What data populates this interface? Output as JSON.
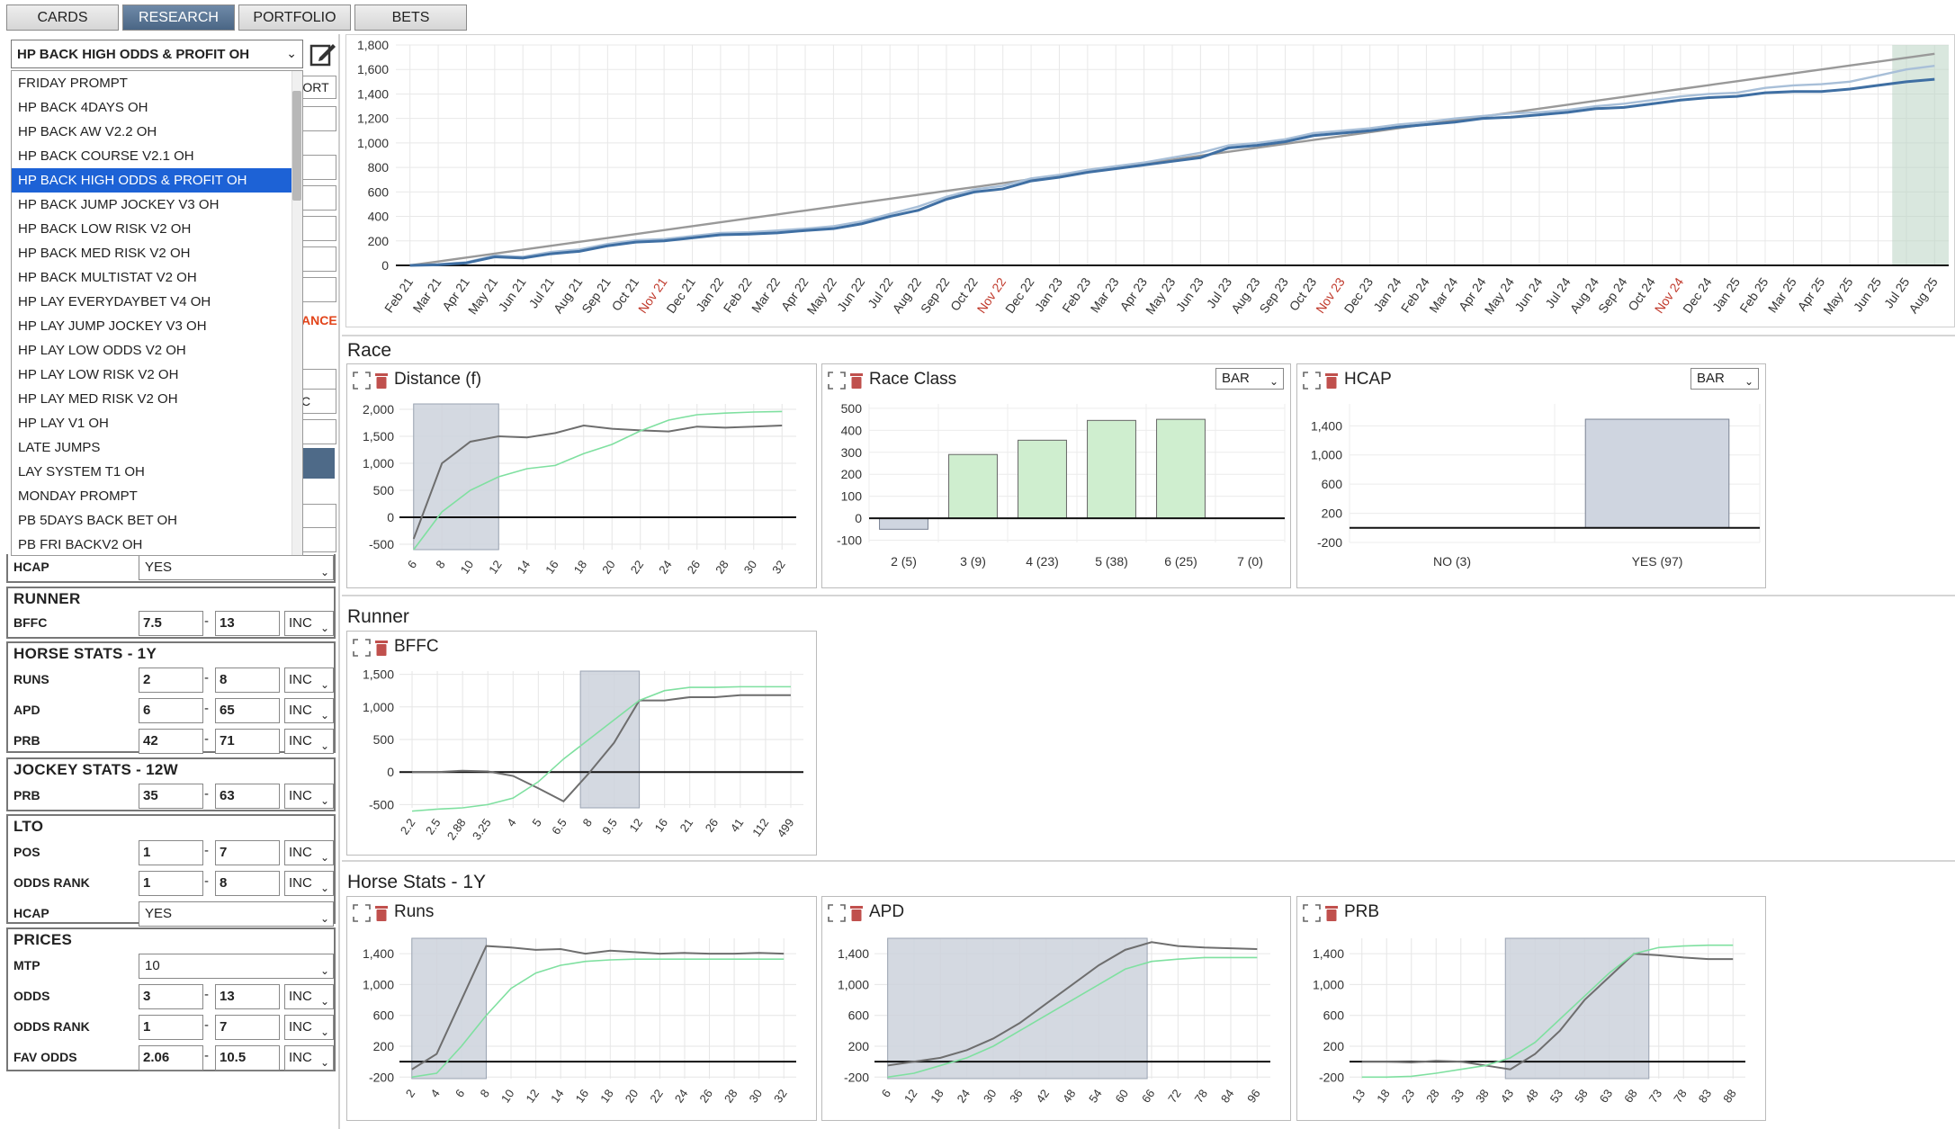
{
  "tabs": [
    "CARDS",
    "RESEARCH",
    "PORTFOLIO",
    "BETS"
  ],
  "system_select": {
    "value": "HP BACK HIGH ODDS & PROFIT OH"
  },
  "dropdown_items": [
    "FRIDAY PROMPT",
    "HP BACK 4DAYS OH",
    "HP BACK AW V2.2 OH",
    "HP BACK COURSE V2.1 OH",
    "HP BACK HIGH ODDS & PROFIT OH",
    "HP BACK JUMP JOCKEY V3 OH",
    "HP BACK LOW RISK V2 OH",
    "HP BACK MED RISK V2 OH",
    "HP BACK MULTISTAT V2 OH",
    "HP LAY EVERYDAYBET V4 OH",
    "HP LAY JUMP JOCKEY V3 OH",
    "HP LAY LOW ODDS V2 OH",
    "HP LAY LOW RISK V2 OH",
    "HP LAY MED RISK V2 OH",
    "HP LAY V1 OH",
    "LATE JUMPS",
    "LAY SYSTEM T1 OH",
    "MONDAY PROMPT",
    "PB 5DAYS BACK BET OH",
    "PB FRI BACKV2 OH"
  ],
  "dropdown_selected_index": 4,
  "partial_labels": {
    "port": "PORT",
    "ance": "ANCE",
    "c": "C"
  },
  "filters": {
    "hcap_top": {
      "label": "HCAP",
      "value": "YES"
    },
    "runner": {
      "title": "RUNNER",
      "bffc": {
        "label": "BFFC",
        "min": "7.5",
        "max": "13",
        "mode": "INC"
      }
    },
    "horse_stats": {
      "title": "HORSE STATS - 1Y",
      "rows": [
        {
          "label": "RUNS",
          "min": "2",
          "max": "8",
          "mode": "INC"
        },
        {
          "label": "APD",
          "min": "6",
          "max": "65",
          "mode": "INC"
        },
        {
          "label": "PRB",
          "min": "42",
          "max": "71",
          "mode": "INC"
        }
      ]
    },
    "jockey_stats": {
      "title": "JOCKEY STATS - 12W",
      "rows": [
        {
          "label": "PRB",
          "min": "35",
          "max": "63",
          "mode": "INC"
        }
      ]
    },
    "lto": {
      "title": "LTO",
      "rows": [
        {
          "label": "POS",
          "min": "1",
          "max": "7",
          "mode": "INC"
        },
        {
          "label": "ODDS RANK",
          "min": "1",
          "max": "8",
          "mode": "INC"
        }
      ],
      "hcap": {
        "label": "HCAP",
        "value": "YES"
      }
    },
    "prices": {
      "title": "PRICES",
      "mtp": {
        "label": "MTP",
        "value": "10"
      },
      "rows": [
        {
          "label": "ODDS",
          "min": "3",
          "max": "13",
          "mode": "INC"
        },
        {
          "label": "ODDS RANK",
          "min": "1",
          "max": "7",
          "mode": "INC"
        },
        {
          "label": "FAV ODDS",
          "min": "2.06",
          "max": "10.5",
          "mode": "INC"
        }
      ]
    }
  },
  "sections": {
    "race": "Race",
    "runner": "Runner",
    "horse_stats": "Horse Stats - 1Y"
  },
  "panel_select_value": "BAR",
  "colors": {
    "accent": "#4a6685",
    "selected": "#1d62d6",
    "green_line": "#7fe0a0",
    "dark_line": "#6e6e6e",
    "band": "#cdd2dc",
    "bar_green": "#cfeecf",
    "bar_gray": "#cfd5e0",
    "main_blue": "#3f6fa3",
    "main_light": "#a8bfd8",
    "trend": "#999999"
  },
  "chart_data": [
    {
      "id": "main",
      "type": "line",
      "x": [
        "Feb 21",
        "Mar 21",
        "Apr 21",
        "May 21",
        "Jun 21",
        "Jul 21",
        "Aug 21",
        "Sep 21",
        "Oct 21",
        "Nov 21",
        "Dec 21",
        "Jan 22",
        "Feb 22",
        "Mar 22",
        "Apr 22",
        "May 22",
        "Jun 22",
        "Jul 22",
        "Aug 22",
        "Sep 22",
        "Oct 22",
        "Nov 22",
        "Dec 22",
        "Jan 23",
        "Feb 23",
        "Mar 23",
        "Apr 23",
        "May 23",
        "Jun 23",
        "Jul 23",
        "Aug 23",
        "Sep 23",
        "Oct 23",
        "Nov 23",
        "Dec 23",
        "Jan 24",
        "Feb 24",
        "Mar 24",
        "Apr 24",
        "May 24",
        "Jun 24",
        "Jul 24",
        "Aug 24",
        "Sep 24",
        "Oct 24",
        "Nov 24",
        "Dec 24",
        "Jan 25",
        "Feb 25",
        "Mar 25",
        "Apr 25",
        "May 25",
        "Jun 25",
        "Jul 25",
        "Aug 25"
      ],
      "yticks": [
        0,
        200,
        400,
        600,
        800,
        1000,
        1200,
        1400,
        1600,
        1800
      ],
      "ylim": [
        0,
        1800
      ],
      "x_red_ticks": [
        "Nov 21",
        "Nov 22",
        "Nov 23",
        "Nov 24"
      ],
      "highlight_range": [
        52.5,
        54.6
      ],
      "series": [
        {
          "role": "trend",
          "values": [
            0,
            32,
            64,
            96,
            128,
            160,
            192,
            224,
            256,
            288,
            320,
            352,
            384,
            416,
            448,
            480,
            512,
            544,
            576,
            608,
            640,
            672,
            704,
            736,
            768,
            800,
            832,
            864,
            896,
            928,
            960,
            992,
            1024,
            1056,
            1088,
            1120,
            1152,
            1184,
            1216,
            1248,
            1280,
            1312,
            1344,
            1376,
            1408,
            1440,
            1472,
            1504,
            1536,
            1568,
            1600,
            1632,
            1664,
            1696,
            1728
          ]
        },
        {
          "role": "light",
          "values": [
            0,
            10,
            25,
            80,
            70,
            110,
            130,
            175,
            205,
            215,
            240,
            265,
            270,
            285,
            300,
            320,
            360,
            420,
            480,
            560,
            620,
            650,
            710,
            740,
            780,
            810,
            840,
            880,
            920,
            980,
            1000,
            1030,
            1080,
            1100,
            1120,
            1150,
            1170,
            1200,
            1220,
            1240,
            1250,
            1270,
            1300,
            1320,
            1350,
            1380,
            1400,
            1410,
            1450,
            1470,
            1480,
            1500,
            1550,
            1600,
            1630
          ]
        },
        {
          "role": "dark",
          "values": [
            0,
            5,
            20,
            70,
            60,
            95,
            115,
            160,
            190,
            200,
            225,
            250,
            255,
            265,
            285,
            300,
            340,
            400,
            450,
            540,
            600,
            625,
            690,
            720,
            760,
            790,
            820,
            850,
            880,
            960,
            980,
            1010,
            1060,
            1080,
            1100,
            1130,
            1150,
            1170,
            1200,
            1210,
            1230,
            1250,
            1280,
            1290,
            1320,
            1350,
            1370,
            1380,
            1410,
            1420,
            1420,
            1440,
            1470,
            1500,
            1520
          ]
        }
      ]
    },
    {
      "id": "distance",
      "title": "Distance (f)",
      "type": "line",
      "x": [
        6,
        8,
        10,
        12,
        14,
        16,
        18,
        20,
        22,
        24,
        26,
        28,
        30,
        32
      ],
      "yticks": [
        2000,
        1500,
        1000,
        500,
        0,
        -500
      ],
      "ylim": [
        -600,
        2100
      ],
      "highlight_range": [
        6,
        12
      ],
      "series": [
        {
          "role": "dark",
          "values": [
            -400,
            1000,
            1400,
            1500,
            1480,
            1560,
            1700,
            1640,
            1610,
            1590,
            1680,
            1660,
            1680,
            1700
          ]
        },
        {
          "role": "green",
          "values": [
            -600,
            100,
            500,
            750,
            900,
            960,
            1180,
            1350,
            1600,
            1800,
            1900,
            1930,
            1950,
            1960
          ]
        }
      ]
    },
    {
      "id": "race_class",
      "title": "Race Class",
      "type": "bar",
      "categories": [
        "2 (5)",
        "3 (9)",
        "4 (23)",
        "5 (38)",
        "6 (25)",
        "7 (0)"
      ],
      "values": [
        -50,
        290,
        355,
        445,
        450,
        0
      ],
      "yticks": [
        500,
        400,
        300,
        200,
        100,
        0,
        -100
      ],
      "ylim": [
        -110,
        520
      ]
    },
    {
      "id": "hcap",
      "title": "HCAP",
      "type": "bar",
      "categories": [
        "NO (3)",
        "YES (97)"
      ],
      "values": [
        0,
        1490
      ],
      "yticks": [
        1400,
        1000,
        600,
        200,
        -200
      ],
      "ylim": [
        -200,
        1700
      ]
    },
    {
      "id": "bffc",
      "title": "BFFC",
      "type": "line",
      "x": [
        "2.2",
        "2.5",
        "2.88",
        "3.25",
        "4",
        "5",
        "6.5",
        "8",
        "9.5",
        "12",
        "16",
        "21",
        "26",
        "41",
        "112",
        "499"
      ],
      "yticks": [
        1500,
        1000,
        500,
        0,
        -500
      ],
      "ylim": [
        -550,
        1550
      ],
      "highlight_range": [
        7.5,
        12
      ],
      "series": [
        {
          "role": "dark",
          "values": [
            0,
            0,
            20,
            10,
            -60,
            -250,
            -450,
            -20,
            450,
            1100,
            1100,
            1150,
            1150,
            1180,
            1180,
            1180
          ]
        },
        {
          "role": "green",
          "values": [
            -600,
            -570,
            -550,
            -500,
            -400,
            -150,
            200,
            500,
            800,
            1100,
            1250,
            1300,
            1300,
            1310,
            1310,
            1310
          ]
        }
      ]
    },
    {
      "id": "runs",
      "title": "Runs",
      "type": "line",
      "x": [
        2,
        4,
        6,
        8,
        10,
        12,
        14,
        16,
        18,
        20,
        22,
        24,
        26,
        28,
        30,
        32
      ],
      "yticks": [
        1400,
        1000,
        600,
        200,
        -200
      ],
      "ylim": [
        -220,
        1600
      ],
      "highlight_range": [
        2,
        8
      ],
      "series": [
        {
          "role": "dark",
          "values": [
            -100,
            100,
            800,
            1500,
            1480,
            1450,
            1460,
            1400,
            1440,
            1420,
            1400,
            1410,
            1400,
            1400,
            1410,
            1400
          ]
        },
        {
          "role": "green",
          "values": [
            -200,
            -150,
            200,
            600,
            950,
            1150,
            1250,
            1300,
            1320,
            1330,
            1330,
            1330,
            1330,
            1330,
            1330,
            1330
          ]
        }
      ]
    },
    {
      "id": "apd",
      "title": "APD",
      "type": "line",
      "x": [
        6,
        12,
        18,
        24,
        30,
        36,
        42,
        48,
        54,
        60,
        66,
        72,
        78,
        84,
        96
      ],
      "yticks": [
        1400,
        1000,
        600,
        200,
        -200
      ],
      "ylim": [
        -220,
        1600
      ],
      "highlight_range": [
        6,
        65
      ],
      "series": [
        {
          "role": "dark",
          "values": [
            -50,
            0,
            50,
            150,
            300,
            500,
            750,
            1000,
            1250,
            1450,
            1550,
            1500,
            1480,
            1470,
            1460
          ]
        },
        {
          "role": "green",
          "values": [
            -200,
            -150,
            -50,
            50,
            200,
            400,
            600,
            800,
            1000,
            1200,
            1300,
            1330,
            1350,
            1350,
            1350
          ]
        }
      ]
    },
    {
      "id": "prb",
      "title": "PRB",
      "type": "line",
      "x": [
        13,
        18,
        23,
        28,
        33,
        38,
        43,
        48,
        53,
        58,
        63,
        68,
        73,
        78,
        83,
        88
      ],
      "yticks": [
        1400,
        1000,
        600,
        200,
        -200
      ],
      "ylim": [
        -220,
        1600
      ],
      "highlight_range": [
        42,
        71
      ],
      "series": [
        {
          "role": "dark",
          "values": [
            0,
            0,
            -10,
            10,
            0,
            -50,
            -100,
            100,
            400,
            800,
            1100,
            1400,
            1380,
            1350,
            1330,
            1330
          ]
        },
        {
          "role": "green",
          "values": [
            -200,
            -200,
            -190,
            -150,
            -100,
            -50,
            50,
            250,
            550,
            850,
            1150,
            1400,
            1480,
            1500,
            1510,
            1510
          ]
        }
      ]
    }
  ]
}
